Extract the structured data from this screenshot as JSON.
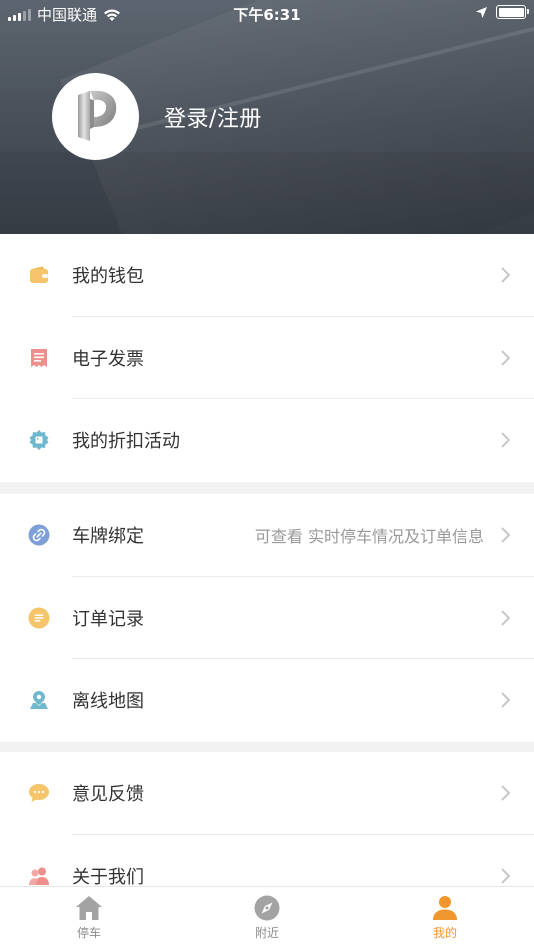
{
  "status_bar": {
    "carrier": "中国联通",
    "time": "下午6:31"
  },
  "header": {
    "login_label": "登录/注册"
  },
  "colors": {
    "accent": "#f0962e",
    "wallet": "#f5c46b",
    "invoice": "#ef8f8b",
    "discount": "#6fb8cf",
    "plate": "#7e9fd8",
    "orders": "#f5c46b",
    "map": "#6fb8cf",
    "feedback": "#f5c46b",
    "about": "#ef8f8b"
  },
  "menu": {
    "section1": [
      {
        "label": "我的钱包",
        "icon": "wallet-icon"
      },
      {
        "label": "电子发票",
        "icon": "receipt-icon"
      },
      {
        "label": "我的折扣活动",
        "icon": "discount-badge-icon"
      }
    ],
    "section2": [
      {
        "label": "车牌绑定",
        "icon": "link-icon",
        "hint": "可查看 实时停车情况及订单信息"
      },
      {
        "label": "订单记录",
        "icon": "list-icon"
      },
      {
        "label": "离线地图",
        "icon": "map-pin-icon"
      }
    ],
    "section3": [
      {
        "label": "意见反馈",
        "icon": "chat-bubble-icon"
      },
      {
        "label": "关于我们",
        "icon": "users-icon"
      }
    ]
  },
  "tabbar": {
    "tabs": [
      {
        "label": "停车",
        "icon": "home-icon"
      },
      {
        "label": "附近",
        "icon": "compass-icon"
      },
      {
        "label": "我的",
        "icon": "person-icon",
        "active": true
      }
    ]
  }
}
